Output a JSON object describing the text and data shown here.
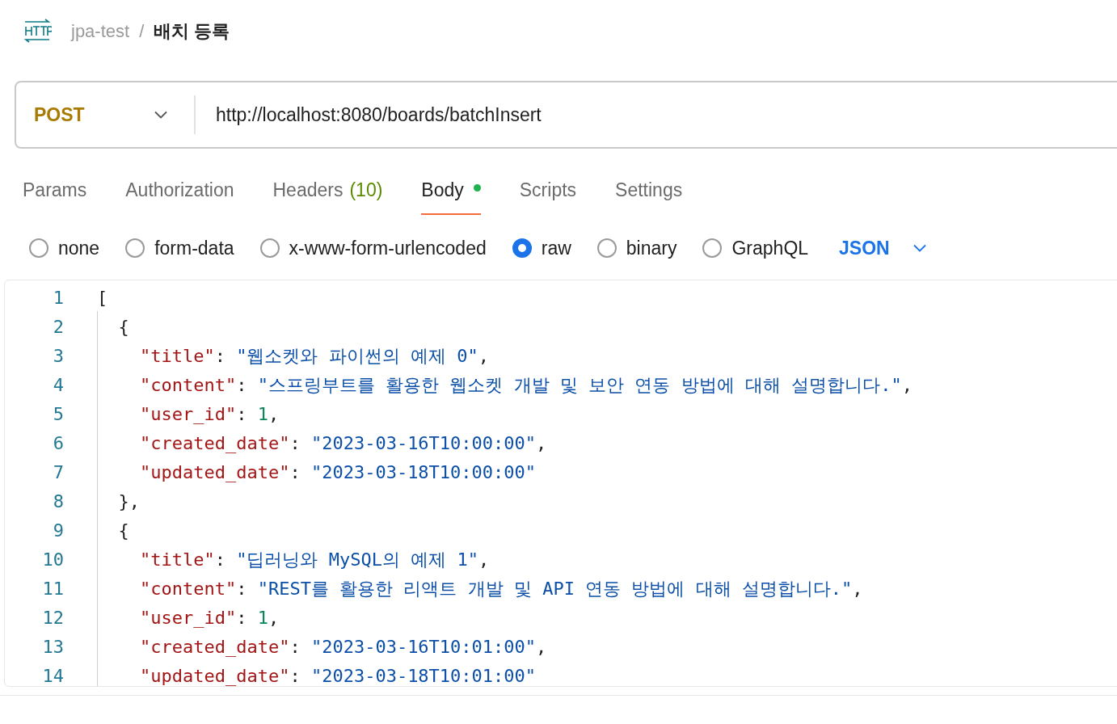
{
  "breadcrumb": {
    "collection": "jpa-test",
    "separator": "/",
    "request": "배치 등록"
  },
  "request": {
    "method": "POST",
    "url": "http://localhost:8080/boards/batchInsert"
  },
  "tabs": [
    {
      "label": "Params",
      "selected": false
    },
    {
      "label": "Authorization",
      "selected": false
    },
    {
      "label": "Headers",
      "count": "(10)",
      "selected": false
    },
    {
      "label": "Body",
      "dot": true,
      "selected": true
    },
    {
      "label": "Scripts",
      "selected": false
    },
    {
      "label": "Settings",
      "selected": false
    }
  ],
  "body_types": [
    {
      "label": "none",
      "selected": false
    },
    {
      "label": "form-data",
      "selected": false
    },
    {
      "label": "x-www-form-urlencoded",
      "selected": false
    },
    {
      "label": "raw",
      "selected": true
    },
    {
      "label": "binary",
      "selected": false
    },
    {
      "label": "GraphQL",
      "selected": false
    }
  ],
  "format": "JSON",
  "editor": {
    "lines": [
      {
        "number": "1",
        "tokens": [
          {
            "kind": "punct",
            "text": "["
          }
        ]
      },
      {
        "number": "2",
        "tokens": [
          {
            "kind": "punct",
            "text": "  {"
          }
        ]
      },
      {
        "number": "3",
        "tokens": [
          {
            "kind": "key",
            "text": "    \"title\""
          },
          {
            "kind": "punct",
            "text": ": "
          },
          {
            "kind": "string",
            "text": "\"웹소켓와 파이썬의 예제 0\""
          },
          {
            "kind": "punct",
            "text": ","
          }
        ]
      },
      {
        "number": "4",
        "tokens": [
          {
            "kind": "key",
            "text": "    \"content\""
          },
          {
            "kind": "punct",
            "text": ": "
          },
          {
            "kind": "string",
            "text": "\"스프링부트를 활용한 웹소켓 개발 및 보안 연동 방법에 대해 설명합니다.\""
          },
          {
            "kind": "punct",
            "text": ","
          }
        ]
      },
      {
        "number": "5",
        "tokens": [
          {
            "kind": "key",
            "text": "    \"user_id\""
          },
          {
            "kind": "punct",
            "text": ": "
          },
          {
            "kind": "number",
            "text": "1"
          },
          {
            "kind": "punct",
            "text": ","
          }
        ]
      },
      {
        "number": "6",
        "tokens": [
          {
            "kind": "key",
            "text": "    \"created_date\""
          },
          {
            "kind": "punct",
            "text": ": "
          },
          {
            "kind": "string",
            "text": "\"2023-03-16T10:00:00\""
          },
          {
            "kind": "punct",
            "text": ","
          }
        ]
      },
      {
        "number": "7",
        "tokens": [
          {
            "kind": "key",
            "text": "    \"updated_date\""
          },
          {
            "kind": "punct",
            "text": ": "
          },
          {
            "kind": "string",
            "text": "\"2023-03-18T10:00:00\""
          }
        ]
      },
      {
        "number": "8",
        "tokens": [
          {
            "kind": "punct",
            "text": "  },"
          }
        ]
      },
      {
        "number": "9",
        "tokens": [
          {
            "kind": "punct",
            "text": "  {"
          }
        ]
      },
      {
        "number": "10",
        "tokens": [
          {
            "kind": "key",
            "text": "    \"title\""
          },
          {
            "kind": "punct",
            "text": ": "
          },
          {
            "kind": "string",
            "text": "\"딥러닝와 MySQL의 예제 1\""
          },
          {
            "kind": "punct",
            "text": ","
          }
        ]
      },
      {
        "number": "11",
        "tokens": [
          {
            "kind": "key",
            "text": "    \"content\""
          },
          {
            "kind": "punct",
            "text": ": "
          },
          {
            "kind": "string",
            "text": "\"REST를 활용한 리액트 개발 및 API 연동 방법에 대해 설명합니다.\""
          },
          {
            "kind": "punct",
            "text": ","
          }
        ]
      },
      {
        "number": "12",
        "tokens": [
          {
            "kind": "key",
            "text": "    \"user_id\""
          },
          {
            "kind": "punct",
            "text": ": "
          },
          {
            "kind": "number",
            "text": "1"
          },
          {
            "kind": "punct",
            "text": ","
          }
        ]
      },
      {
        "number": "13",
        "tokens": [
          {
            "kind": "key",
            "text": "    \"created_date\""
          },
          {
            "kind": "punct",
            "text": ": "
          },
          {
            "kind": "string",
            "text": "\"2023-03-16T10:01:00\""
          },
          {
            "kind": "punct",
            "text": ","
          }
        ]
      },
      {
        "number": "14",
        "tokens": [
          {
            "kind": "key",
            "text": "    \"updated_date\""
          },
          {
            "kind": "punct",
            "text": ": "
          },
          {
            "kind": "string",
            "text": "\"2023-03-18T10:01:00\""
          }
        ]
      }
    ]
  }
}
